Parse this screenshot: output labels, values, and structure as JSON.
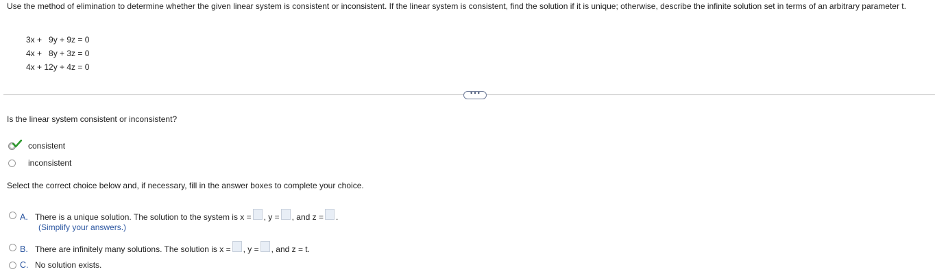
{
  "instructions": "Use the method of elimination to determine whether the given linear system is consistent or inconsistent. If the linear system is consistent, find the solution if it is unique; otherwise, describe the infinite solution set in terms of an arbitrary parameter t.",
  "system": {
    "equations": [
      "3x +   9y + 9z = 0",
      "4x +   8y + 3z = 0",
      "4x + 12y + 4z = 0"
    ]
  },
  "more_button_label": "•••",
  "question1": {
    "prompt": "Is the linear system consistent or inconsistent?",
    "options": [
      {
        "label": "consistent",
        "selected": true,
        "correct": true
      },
      {
        "label": "inconsistent",
        "selected": false
      }
    ]
  },
  "question2": {
    "prompt": "Select the correct choice below and, if necessary, fill in the answer boxes to complete your choice.",
    "choices": [
      {
        "letter": "A.",
        "text_before": "There is a unique solution. The solution to the system is x =",
        "y_label": ", y =",
        "z_label": ", and z =",
        "end": ".",
        "hint": "(Simplify your answers.)"
      },
      {
        "letter": "B.",
        "text_before": "There are infinitely many solutions. The solution is x =",
        "y_label": ", y =",
        "end": ", and z = t."
      },
      {
        "letter": "C.",
        "text": "No solution exists."
      }
    ]
  },
  "colors": {
    "accent": "#2a55a0",
    "check": "#2e9a2e",
    "answer_box": "#e8eef6"
  }
}
